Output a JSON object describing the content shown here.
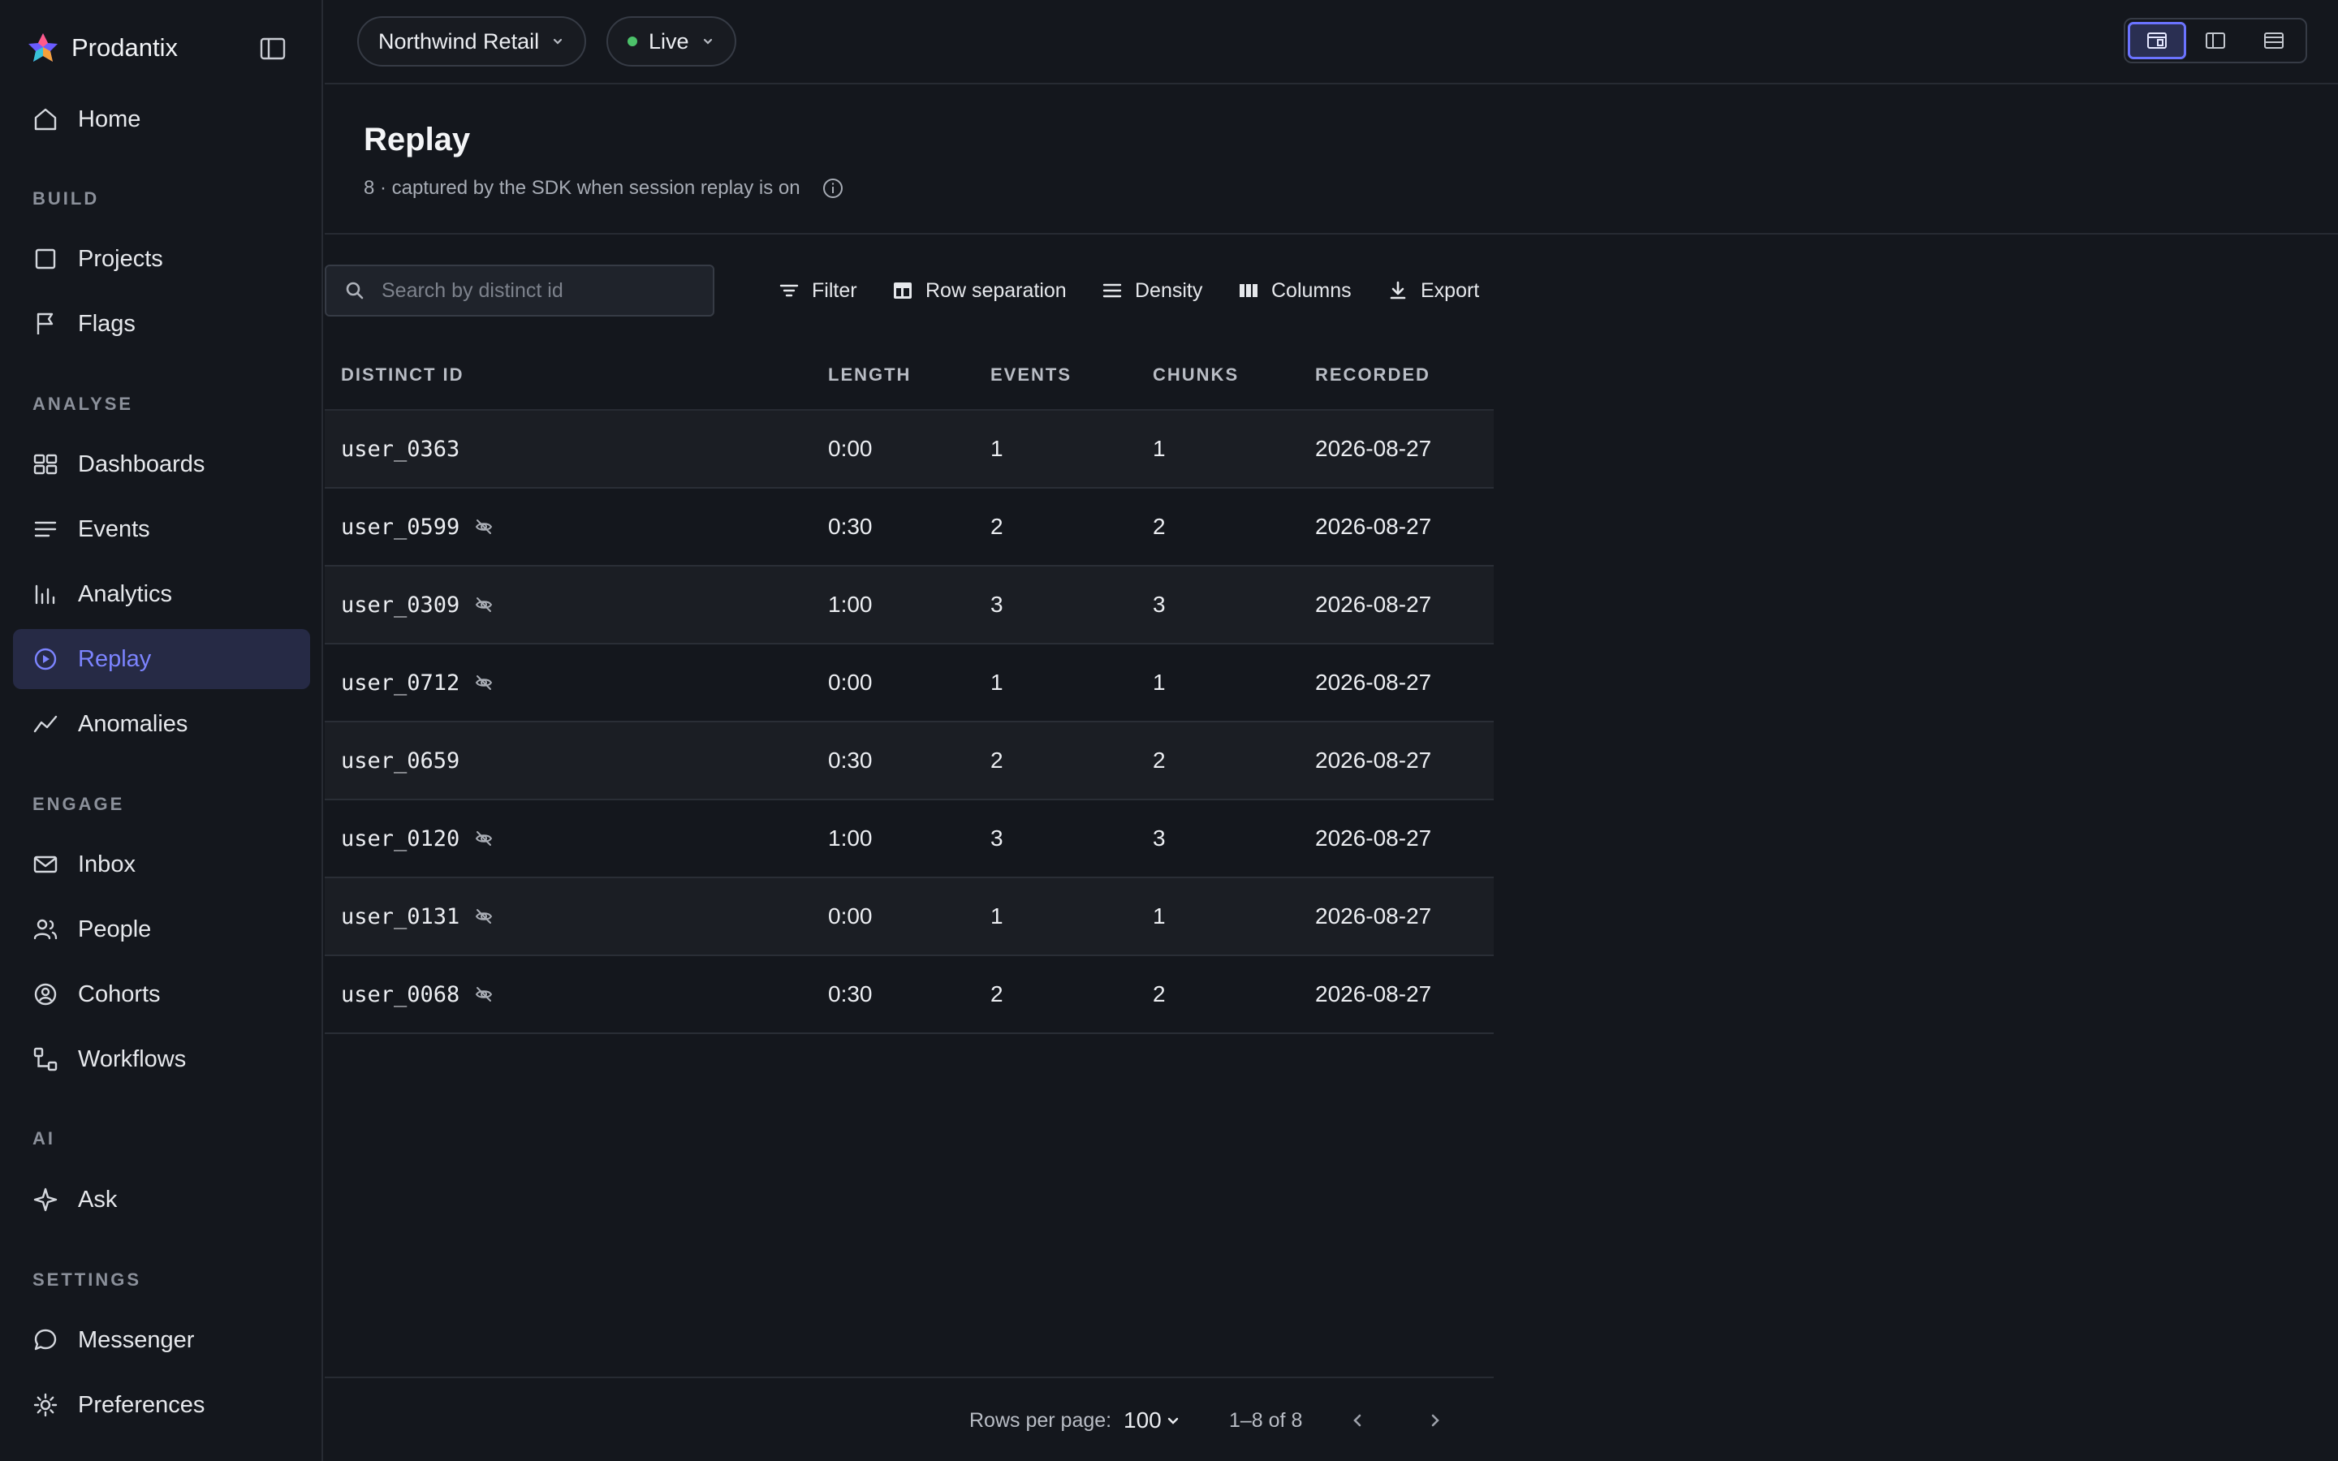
{
  "brand": {
    "name": "Prodantix"
  },
  "sidebar": {
    "home": "Home",
    "sections": {
      "build": "BUILD",
      "analyse": "ANALYSE",
      "engage": "ENGAGE",
      "ai": "AI",
      "settings": "SETTINGS"
    },
    "items": {
      "projects": "Projects",
      "flags": "Flags",
      "dashboards": "Dashboards",
      "events": "Events",
      "analytics": "Analytics",
      "replay": "Replay",
      "anomalies": "Anomalies",
      "inbox": "Inbox",
      "people": "People",
      "cohorts": "Cohorts",
      "workflows": "Workflows",
      "ask": "Ask",
      "messenger": "Messenger",
      "preferences": "Preferences"
    },
    "active": "replay"
  },
  "topbar": {
    "project": "Northwind Retail",
    "environment": "Live",
    "environment_status_color": "#4cc26a"
  },
  "page": {
    "title": "Replay",
    "subtitle": "8 · captured by the SDK when session replay is on"
  },
  "toolbar": {
    "search_placeholder": "Search by distinct id",
    "filter": "Filter",
    "row_separation": "Row separation",
    "density": "Density",
    "columns": "Columns",
    "export": "Export"
  },
  "table": {
    "columns": [
      "DISTINCT ID",
      "LENGTH",
      "EVENTS",
      "CHUNKS",
      "RECORDED"
    ],
    "rows": [
      {
        "id": "user_0363",
        "hidden": false,
        "length": "0:00",
        "events": "1",
        "chunks": "1",
        "recorded": "2026-08-27"
      },
      {
        "id": "user_0599",
        "hidden": true,
        "length": "0:30",
        "events": "2",
        "chunks": "2",
        "recorded": "2026-08-27"
      },
      {
        "id": "user_0309",
        "hidden": true,
        "length": "1:00",
        "events": "3",
        "chunks": "3",
        "recorded": "2026-08-27"
      },
      {
        "id": "user_0712",
        "hidden": true,
        "length": "0:00",
        "events": "1",
        "chunks": "1",
        "recorded": "2026-08-27"
      },
      {
        "id": "user_0659",
        "hidden": false,
        "length": "0:30",
        "events": "2",
        "chunks": "2",
        "recorded": "2026-08-27"
      },
      {
        "id": "user_0120",
        "hidden": true,
        "length": "1:00",
        "events": "3",
        "chunks": "3",
        "recorded": "2026-08-27"
      },
      {
        "id": "user_0131",
        "hidden": true,
        "length": "0:00",
        "events": "1",
        "chunks": "1",
        "recorded": "2026-08-27"
      },
      {
        "id": "user_0068",
        "hidden": true,
        "length": "0:30",
        "events": "2",
        "chunks": "2",
        "recorded": "2026-08-27"
      }
    ]
  },
  "footer": {
    "rows_per_page_label": "Rows per page:",
    "rows_per_page": "100",
    "range": "1–8 of 8"
  },
  "colors": {
    "accent": "#7c84ff",
    "background": "#14171d"
  }
}
